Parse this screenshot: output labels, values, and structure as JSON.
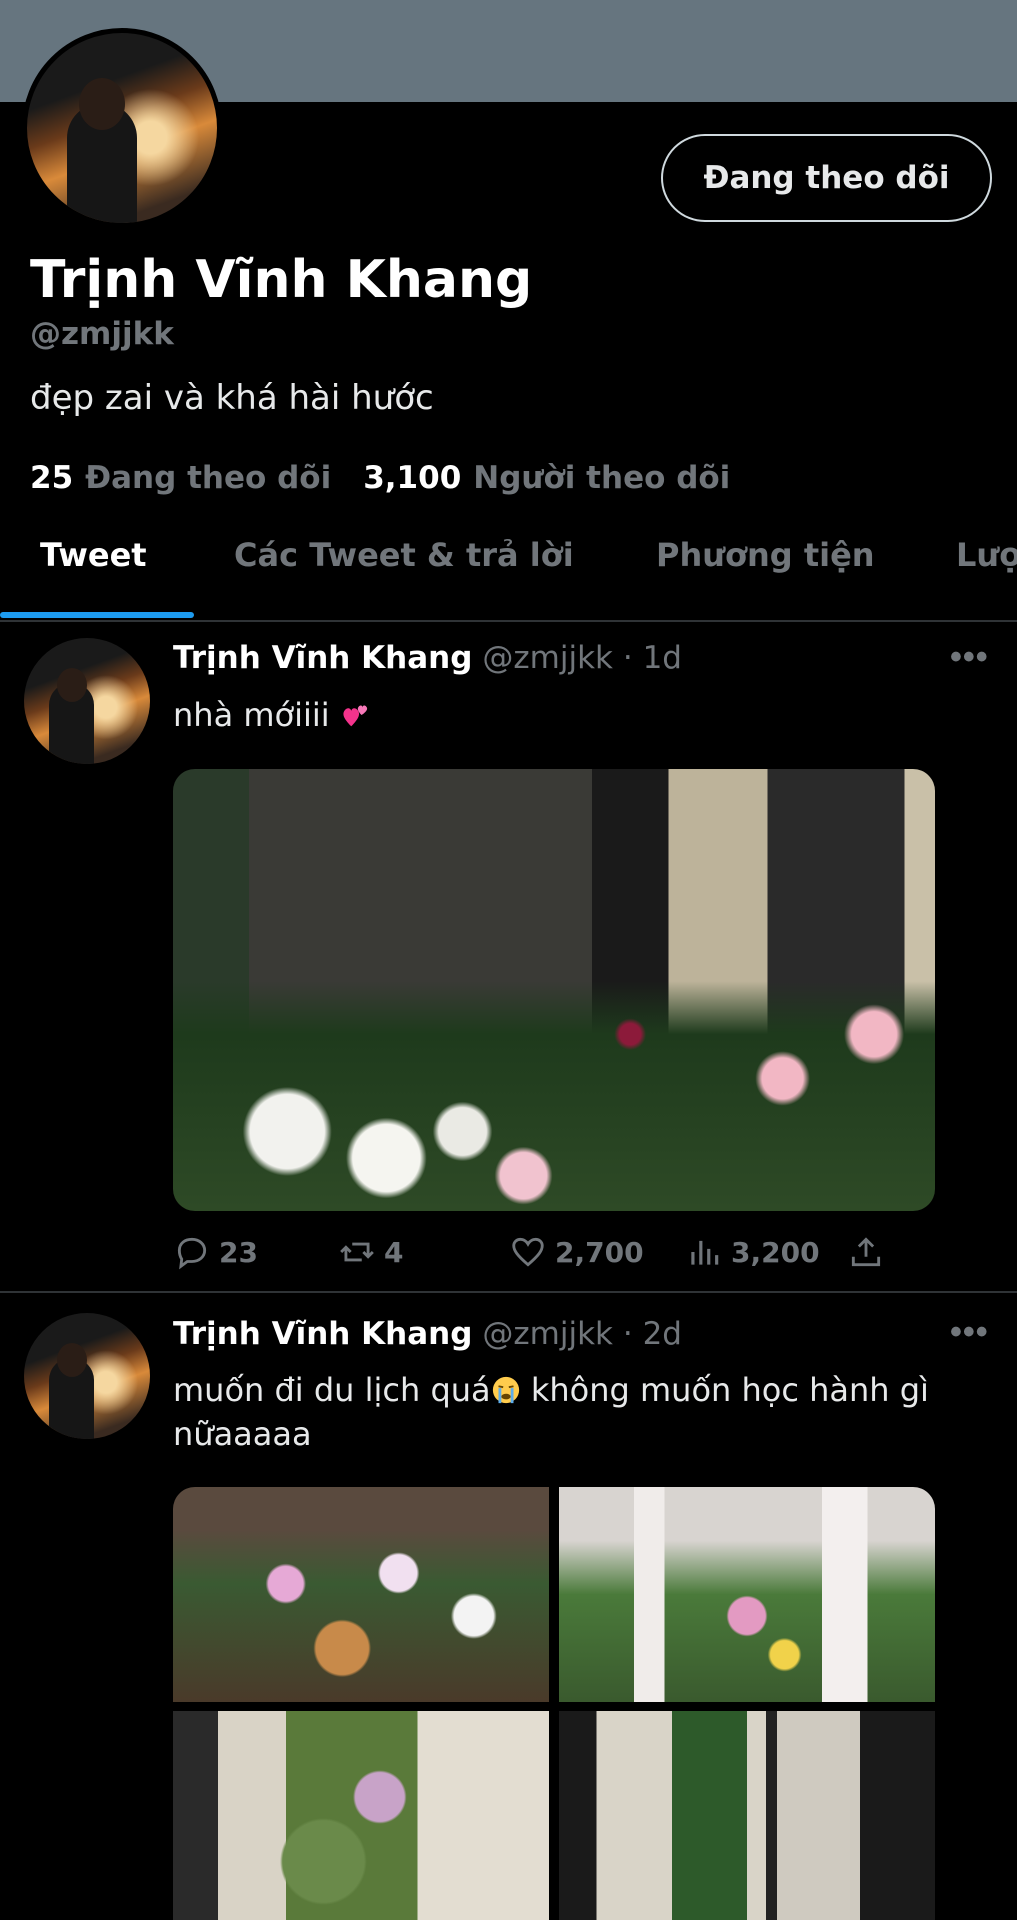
{
  "profile": {
    "name": "Trịnh Vĩnh Khang",
    "handle": "@zmjjkk",
    "bio": "đẹp zai và khá hài hước",
    "follow_button": "Đang theo dõi",
    "following_count": "25",
    "following_label": "Đang theo dõi",
    "followers_count": "3,100",
    "followers_label": "Người theo dõi"
  },
  "tabs": [
    {
      "label": "Tweet",
      "active": true
    },
    {
      "label": "Các Tweet & trả lời",
      "active": false
    },
    {
      "label": "Phương tiện",
      "active": false
    },
    {
      "label": "Lượt thích",
      "active": false
    }
  ],
  "tweets": [
    {
      "name": "Trịnh Vĩnh Khang",
      "meta": "@zmjjkk · 1d",
      "text": "nhà mớiiii",
      "emoji": "two-hearts",
      "replies": "23",
      "retweets": "4",
      "likes": "2,700",
      "views": "3,200"
    },
    {
      "name": "Trịnh Vĩnh Khang",
      "meta": "@zmjjkk · 2d",
      "text": "muốn đi du lịch quá",
      "emoji": "crying-face",
      "text2": " không muốn học hành gì nữaaaaa"
    }
  ],
  "colors": {
    "banner": "#66757f",
    "accent": "#1d9bf0",
    "muted": "#71767b"
  }
}
